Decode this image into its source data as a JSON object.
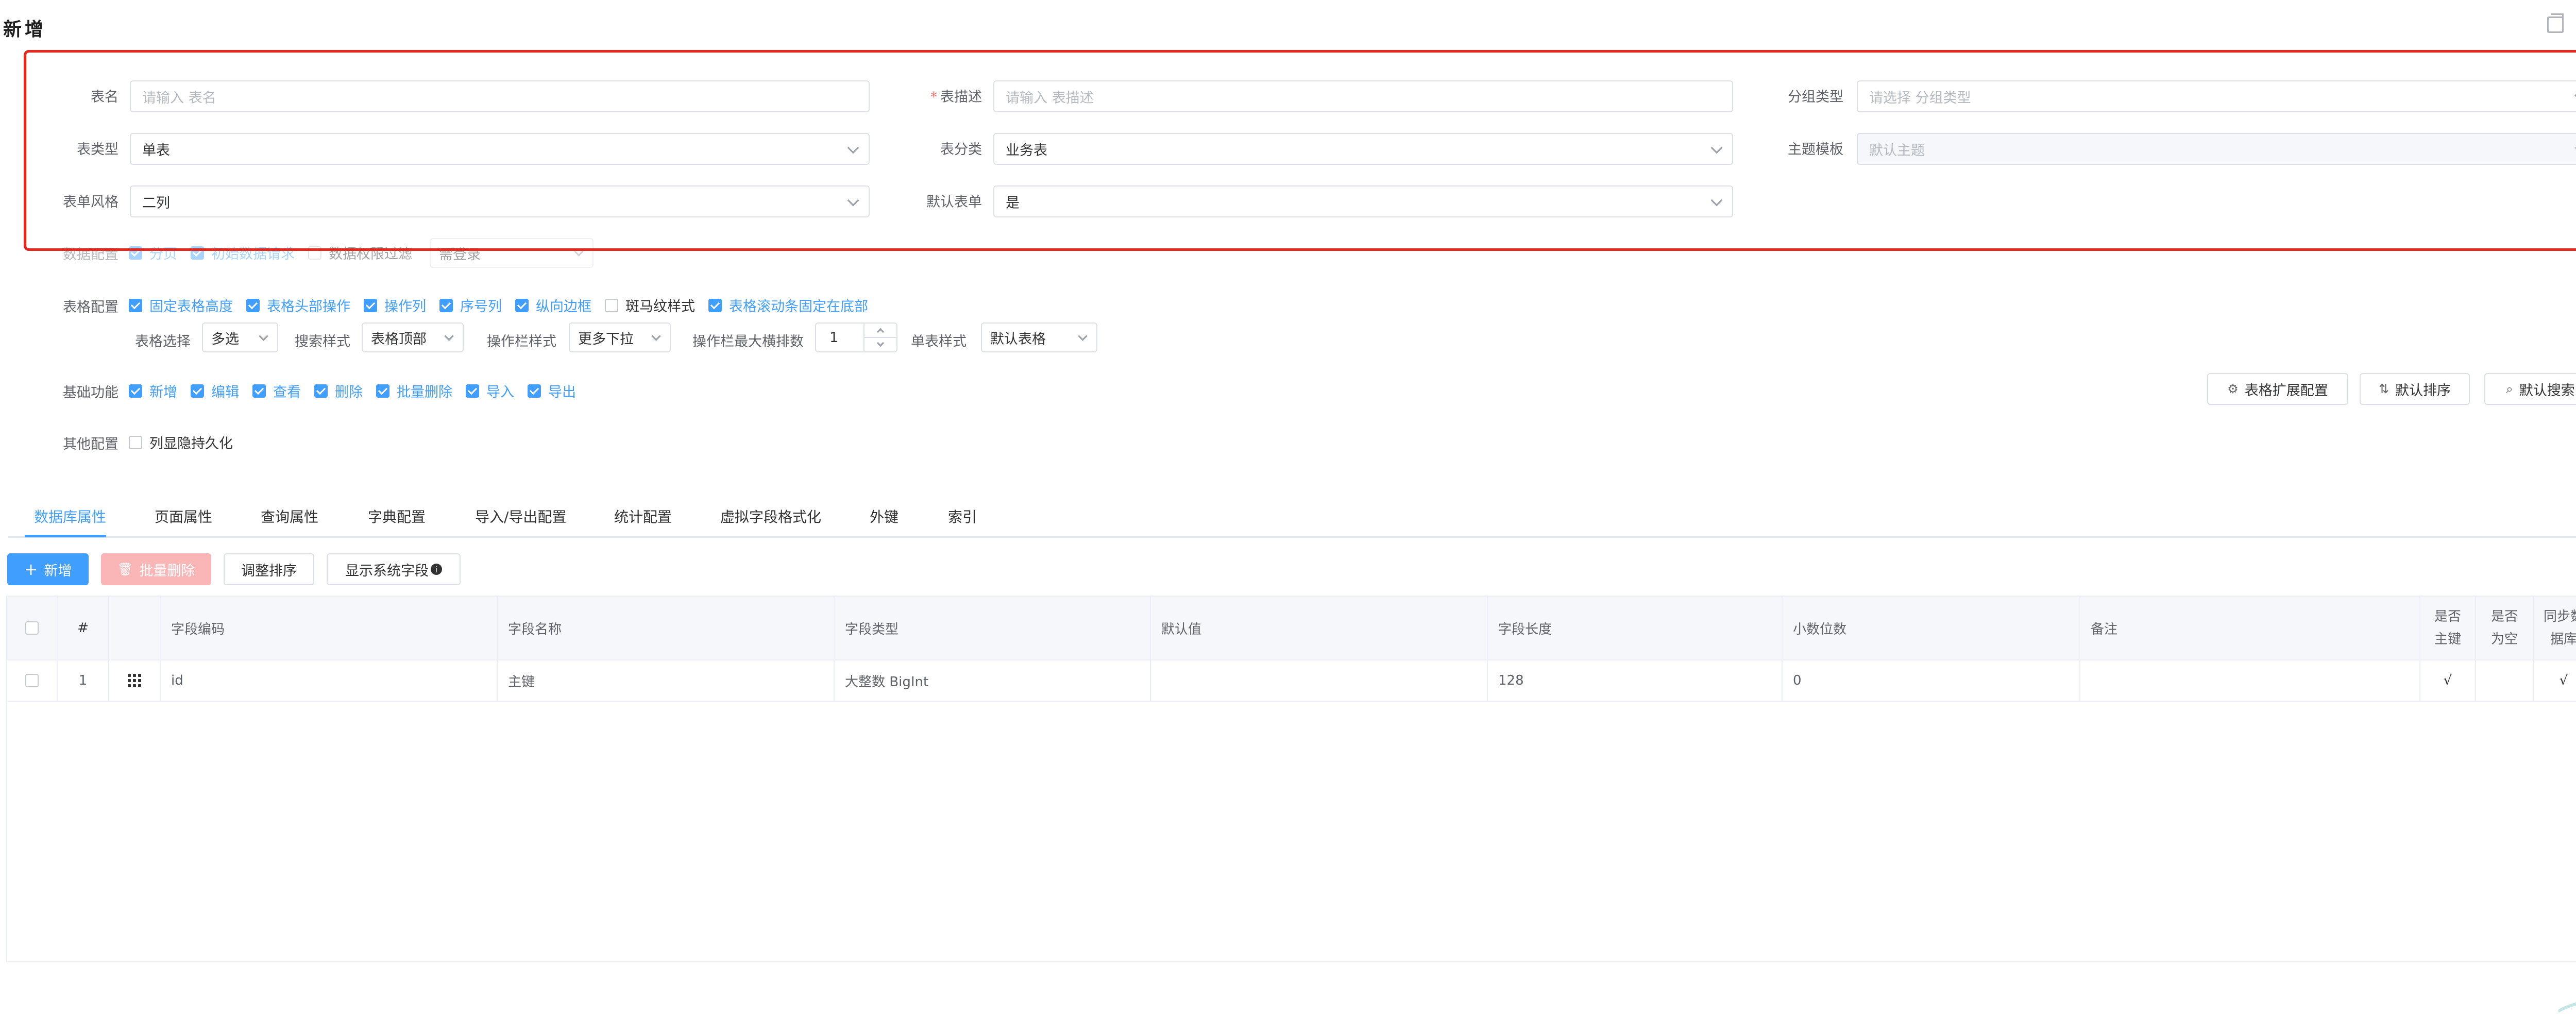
{
  "dialog": {
    "title": "新增"
  },
  "form": {
    "table_name": {
      "label": "表名",
      "placeholder": "请输入 表名"
    },
    "table_desc": {
      "label": "表描述",
      "required_mark": "*",
      "placeholder": "请输入 表描述"
    },
    "group_type": {
      "label": "分组类型",
      "placeholder": "请选择 分组类型"
    },
    "table_type": {
      "label": "表类型",
      "value": "单表"
    },
    "table_category": {
      "label": "表分类",
      "value": "业务表"
    },
    "theme_template": {
      "label": "主题模板",
      "value": "默认主题"
    },
    "form_style": {
      "label": "表单风格",
      "value": "二列"
    },
    "default_form": {
      "label": "默认表单",
      "value": "是"
    }
  },
  "data_config": {
    "label": "数据配置",
    "items": [
      {
        "text": "分页",
        "checked": true
      },
      {
        "text": "初始数据请求",
        "checked": true
      },
      {
        "text": "数据权限过滤",
        "checked": false
      }
    ],
    "select_value": "需登录"
  },
  "table_config": {
    "label": "表格配置",
    "items": [
      {
        "text": "固定表格高度",
        "checked": true
      },
      {
        "text": "表格头部操作",
        "checked": true
      },
      {
        "text": "操作列",
        "checked": true
      },
      {
        "text": "序号列",
        "checked": true
      },
      {
        "text": "纵向边框",
        "checked": true
      },
      {
        "text": "斑马纹样式",
        "checked": false
      },
      {
        "text": "表格滚动条固定在底部",
        "checked": true
      }
    ],
    "table_select": {
      "label": "表格选择",
      "value": "多选"
    },
    "search_style": {
      "label": "搜索样式",
      "value": "表格顶部"
    },
    "action_style": {
      "label": "操作栏样式",
      "value": "更多下拉"
    },
    "action_max": {
      "label": "操作栏最大横排数",
      "value": "1"
    },
    "single_style": {
      "label": "单表样式",
      "value": "默认表格"
    }
  },
  "basic_funcs": {
    "label": "基础功能",
    "items": [
      {
        "text": "新增",
        "checked": true
      },
      {
        "text": "编辑",
        "checked": true
      },
      {
        "text": "查看",
        "checked": true
      },
      {
        "text": "删除",
        "checked": true
      },
      {
        "text": "批量删除",
        "checked": true
      },
      {
        "text": "导入",
        "checked": true
      },
      {
        "text": "导出",
        "checked": true
      }
    ],
    "buttons": {
      "ext_config": "表格扩展配置",
      "default_sort": "默认排序",
      "default_search": "默认搜索"
    }
  },
  "other_config": {
    "label": "其他配置",
    "items": [
      {
        "text": "列显隐持久化",
        "checked": false
      }
    ]
  },
  "tabs": [
    {
      "label": "数据库属性",
      "active": true
    },
    {
      "label": "页面属性"
    },
    {
      "label": "查询属性"
    },
    {
      "label": "字典配置"
    },
    {
      "label": "导入/导出配置"
    },
    {
      "label": "统计配置"
    },
    {
      "label": "虚拟字段格式化"
    },
    {
      "label": "外键"
    },
    {
      "label": "索引"
    }
  ],
  "toolbar": {
    "add": "新增",
    "batch_delete": "批量删除",
    "adjust_sort": "调整排序",
    "show_system_fields": "显示系统字段"
  },
  "grid": {
    "columns": [
      "#",
      "字段编码",
      "字段名称",
      "字段类型",
      "默认值",
      "字段长度",
      "小数位数",
      "备注",
      "是否主键",
      "是否为空",
      "同步数据库"
    ],
    "rows": [
      {
        "index": "1",
        "code": "id",
        "name": "主键",
        "type": "大整数 BigInt",
        "default": "",
        "length": "128",
        "decimal": "0",
        "remark": "",
        "pk": "√",
        "nullable": "",
        "sync": "√"
      }
    ]
  },
  "colors": {
    "primary": "#409eff",
    "highlight_border": "#e5281e",
    "danger_disabled": "#fab6b6"
  }
}
